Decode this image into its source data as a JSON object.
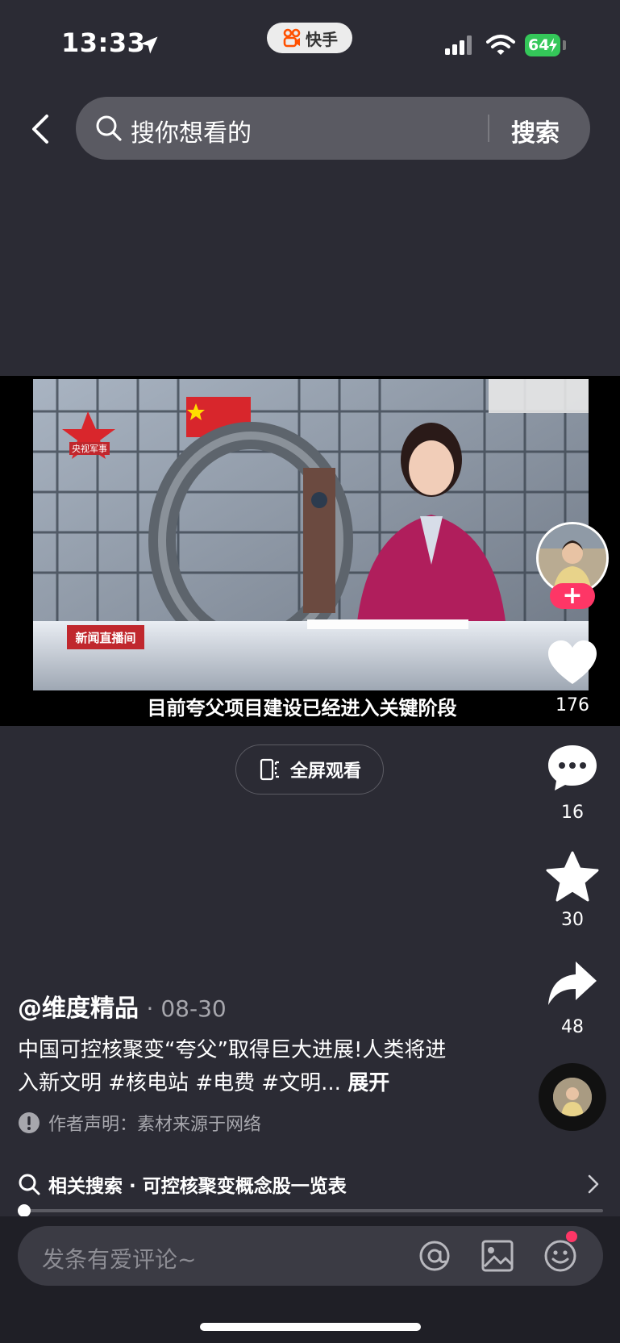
{
  "status_bar": {
    "time": "13:33",
    "app_label": "快手",
    "battery": "64"
  },
  "search": {
    "placeholder": "搜你想看的",
    "submit_label": "搜索"
  },
  "video": {
    "caption": "目前夸父项目建设已经进入关键阶段",
    "channel_logo_text": "央视军事",
    "program_logo_text": "新闻直播间"
  },
  "fullscreen": {
    "label": "全屏观看"
  },
  "actions": {
    "like_count": "176",
    "comment_count": "16",
    "favorite_count": "30",
    "share_count": "48",
    "follow_symbol": "+"
  },
  "post": {
    "author": "@维度精品",
    "date": "· 08-30",
    "description": "中国可控核聚变“夸父”取得巨大进展!人类将进入新文明 #核电站 #电费 #文明...",
    "expand_label": "展开",
    "notice": "作者声明：素材来源于网络"
  },
  "related_search": {
    "label": "相关搜索 · 可控核聚变概念股一览表"
  },
  "progress": {
    "fraction": 0.01
  },
  "comment": {
    "placeholder": "发条有爱评论~"
  },
  "colors": {
    "background": "#2b2b34",
    "accent": "#fe3666",
    "battery_green": "#34c759"
  }
}
